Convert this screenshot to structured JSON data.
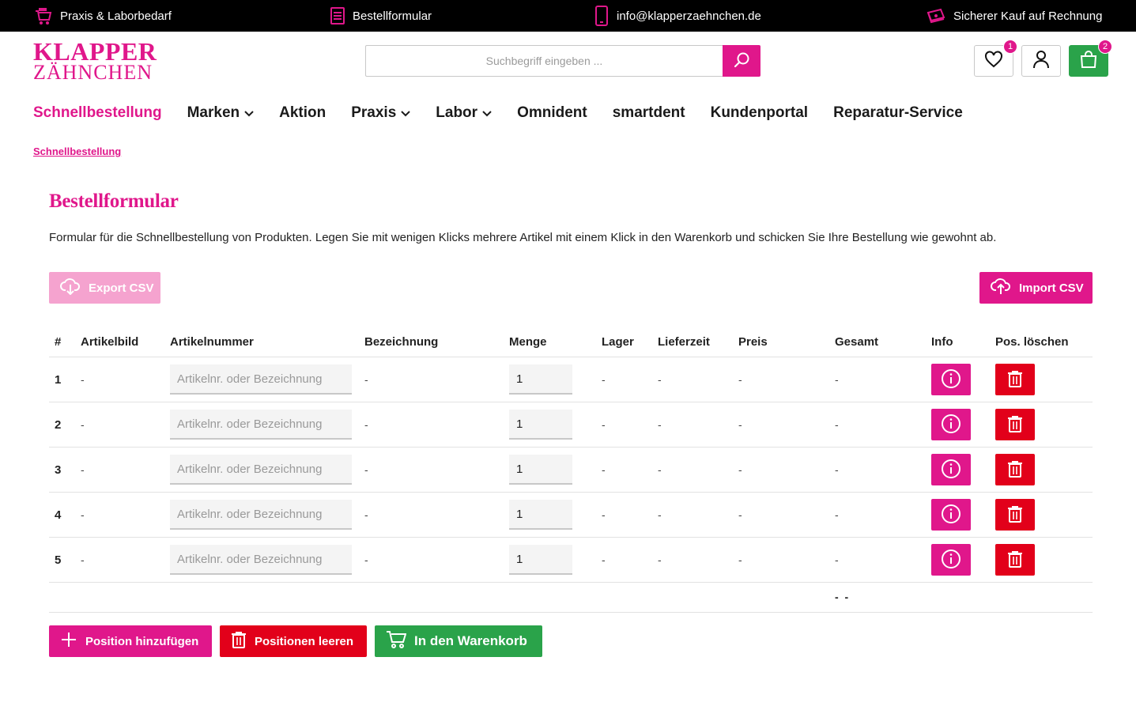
{
  "topbar": {
    "item1": "Praxis & Laborbedarf",
    "item2": "Bestellformular",
    "item3": "info@klapperzaehnchen.de",
    "item4": "Sicherer Kauf auf Rechnung"
  },
  "logo": {
    "line1": "KLAPPER",
    "line2": "ZÄHNCHEN"
  },
  "search": {
    "placeholder": "Suchbegriff eingeben ..."
  },
  "header": {
    "wishlist_count": "1",
    "cart_count": "2"
  },
  "nav": {
    "items": [
      {
        "label": "Schnellbestellung"
      },
      {
        "label": "Marken"
      },
      {
        "label": "Aktion"
      },
      {
        "label": "Praxis"
      },
      {
        "label": "Labor"
      },
      {
        "label": "Omnident"
      },
      {
        "label": "smartdent"
      },
      {
        "label": "Kundenportal"
      },
      {
        "label": "Reparatur-Service"
      }
    ]
  },
  "breadcrumb": "Schnellbestellung",
  "page": {
    "title": "Bestellformular",
    "description": "Formular für die Schnellbestellung von Produkten. Legen Sie mit wenigen Klicks mehrere Artikel mit einem Klick in den Warenkorb und schicken Sie Ihre Bestellung wie gewohnt ab."
  },
  "buttons": {
    "export": "Export CSV",
    "import": "Import CSV",
    "add": "Position hinzufügen",
    "clear": "Positionen leeren",
    "cart": "In den Warenkorb"
  },
  "table": {
    "headers": {
      "num": "#",
      "image": "Artikelbild",
      "artnr": "Artikelnummer",
      "desc": "Bezeichnung",
      "qty": "Menge",
      "stock": "Lager",
      "delivery": "Lieferzeit",
      "price": "Preis",
      "total": "Gesamt",
      "info": "Info",
      "delete": "Pos. löschen"
    },
    "artnr_placeholder": "Artikelnr. oder Bezeichnung",
    "rows": [
      {
        "num": "1",
        "image": "-",
        "desc": "-",
        "qty": "1",
        "stock": "-",
        "delivery": "-",
        "price": "-",
        "total": "-"
      },
      {
        "num": "2",
        "image": "-",
        "desc": "-",
        "qty": "1",
        "stock": "-",
        "delivery": "-",
        "price": "-",
        "total": "-"
      },
      {
        "num": "3",
        "image": "-",
        "desc": "-",
        "qty": "1",
        "stock": "-",
        "delivery": "-",
        "price": "-",
        "total": "-"
      },
      {
        "num": "4",
        "image": "-",
        "desc": "-",
        "qty": "1",
        "stock": "-",
        "delivery": "-",
        "price": "-",
        "total": "-"
      },
      {
        "num": "5",
        "image": "-",
        "desc": "-",
        "qty": "1",
        "stock": "-",
        "delivery": "-",
        "price": "-",
        "total": "-"
      }
    ],
    "grand_total": "- -"
  },
  "colors": {
    "brand": "#e0178b",
    "danger": "#e2001a",
    "success": "#2aa34a"
  }
}
